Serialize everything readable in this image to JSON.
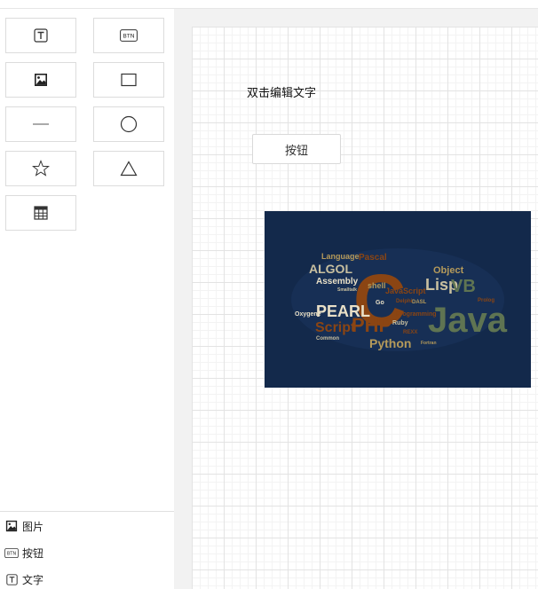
{
  "toolbox": {
    "tools": [
      {
        "name": "text-tool-button",
        "icon": "text-icon"
      },
      {
        "name": "button-tool-button",
        "icon": "btn-icon",
        "icon_text": "BTN"
      },
      {
        "name": "image-tool-button",
        "icon": "image-icon"
      },
      {
        "name": "rectangle-tool-button",
        "icon": "rectangle-icon"
      },
      {
        "name": "line-tool-button",
        "icon": "line-icon"
      },
      {
        "name": "circle-tool-button",
        "icon": "circle-icon"
      },
      {
        "name": "star-tool-button",
        "icon": "star-icon"
      },
      {
        "name": "triangle-tool-button",
        "icon": "triangle-icon"
      },
      {
        "name": "table-tool-button",
        "icon": "table-icon"
      }
    ]
  },
  "layers": {
    "items": [
      {
        "label": "图片",
        "icon": "image-icon"
      },
      {
        "label": "按钮",
        "icon": "btn-icon",
        "icon_text": "BTN"
      },
      {
        "label": "文字",
        "icon": "text-icon"
      }
    ]
  },
  "canvas": {
    "text_element": "双击编辑文字",
    "button_element": "按钮",
    "image_element": {
      "words": [
        "C",
        "Java",
        "PHP",
        "PEARL",
        "Lisp",
        "VB",
        "ALGOL",
        "Script",
        "Python",
        "Assembly",
        "Language",
        "Pascal",
        "Object",
        "JavaScript",
        "shell",
        "Oxygene",
        "Ruby",
        "Programming",
        "Common",
        "Delphi",
        "Go",
        "REXX",
        "Prolog",
        "DASL",
        "Smalltalk",
        "Fortran"
      ],
      "colors": {
        "background": "#13294b",
        "accent": "#8b4513",
        "muted": "#5f7452"
      }
    }
  }
}
